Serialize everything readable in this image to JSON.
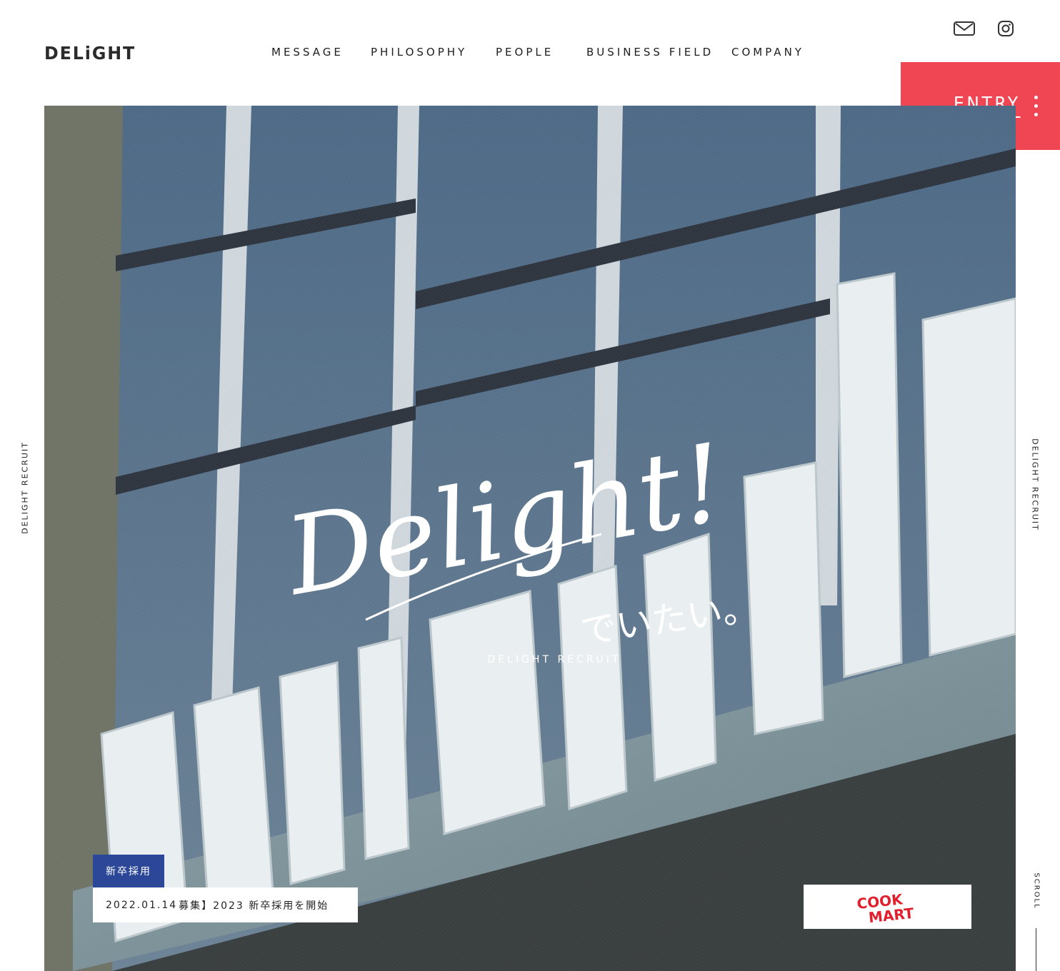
{
  "header": {
    "logo": "DELiGHT",
    "nav": [
      "MESSAGE",
      "PHILOSOPHY",
      "PEOPLE",
      "BUSINESS FIELD",
      "COMPANY"
    ],
    "icons": [
      "mail-icon",
      "instagram-icon"
    ],
    "entry_label": "ENTRY"
  },
  "hero": {
    "script_title": "Delight!",
    "script_subtitle": "でいたい。",
    "subtitle": "DELIGHT RECRUIT",
    "side_left": "DELIGHT RECRUIT",
    "side_right": "DELIGHT RECRUIT",
    "scroll": "SCROLL"
  },
  "news": {
    "tag": "新卒採用",
    "date": "2022.01.14",
    "title": "募集】2023 新卒採用を開始"
  },
  "banner": {
    "brand_line1": "COOK",
    "brand_line2": "MART"
  },
  "colors": {
    "accent": "#f04553",
    "news_tag": "#2c4797",
    "brand_red": "#e0202f"
  }
}
